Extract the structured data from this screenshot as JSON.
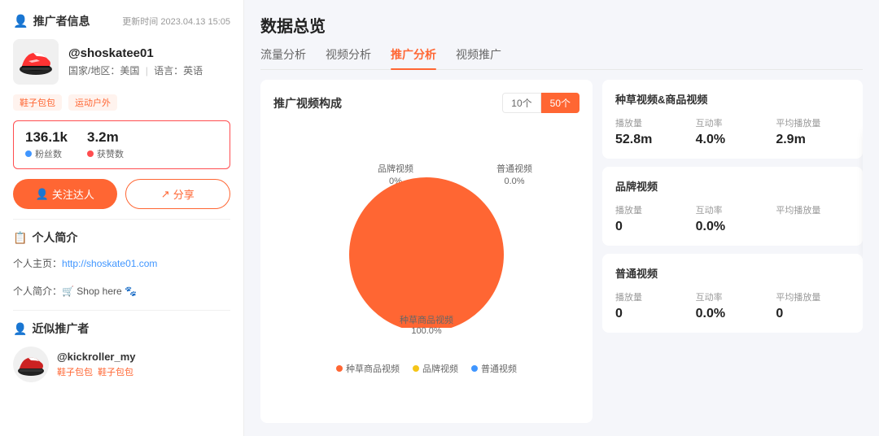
{
  "leftPanel": {
    "title": "推广者信息",
    "updateTime": "更新时间 2023.04.13 15:05",
    "username": "@shoskatee01",
    "country": "国家/地区：美国",
    "language": "语言：英语",
    "tags": [
      "鞋子包包",
      "运动户外"
    ],
    "followers": "136.1k",
    "likes": "3.2m",
    "followersLabel": "粉丝数",
    "likesLabel": "获赞数",
    "followBtn": "关注达人",
    "shareBtn": "分享",
    "bioTitle": "个人简介",
    "bioHome": "个人主页：http://shoskate01.com",
    "bioShop": "个人简介：🛒 Shop here 🐾",
    "similarTitle": "近似推广者",
    "similarUser": "@kickroller_my",
    "similarTag1": "鞋子包包",
    "similarTag2": "鞋子包包"
  },
  "rightPanel": {
    "mainTitle": "数据总览",
    "tabs": [
      "流量分析",
      "视频分析",
      "推广分析",
      "视频推广"
    ],
    "activeTab": 2,
    "sectionTitle": "推广视频构成",
    "chartBtns": [
      "10个",
      "50个"
    ],
    "activeChartBtn": 1,
    "pieData": {
      "seedCommerce": 100.0,
      "brand": 0.0,
      "normal": 0.0
    },
    "pieLabels": {
      "brand": "品牌视频\n0.0%",
      "normal": "普通视频\n0.0%",
      "seed": "种草商品视频\n100.0%"
    },
    "legend": [
      "种草商品视频",
      "品牌视频",
      "普通视频"
    ],
    "legendColors": [
      "#ff6633",
      "#f5c518",
      "#4096ff"
    ],
    "cards": [
      {
        "title": "种草视频&商品视频",
        "metrics": [
          {
            "label": "播放量",
            "value": "52.8m"
          },
          {
            "label": "互动率",
            "value": "4.0%"
          },
          {
            "label": "平均播放量",
            "value": "2.9m"
          }
        ]
      },
      {
        "title": "品牌视频",
        "metrics": [
          {
            "label": "播放量",
            "value": "0"
          },
          {
            "label": "互动率",
            "value": "0.0%"
          },
          {
            "label": "平均播放量",
            "value": ""
          }
        ]
      },
      {
        "title": "普通视频",
        "metrics": [
          {
            "label": "播放量",
            "value": "0"
          },
          {
            "label": "互动率",
            "value": "0.0%"
          },
          {
            "label": "平均播放量",
            "value": "0"
          }
        ]
      }
    ],
    "floatIcons": [
      "↑",
      "♛",
      "ꙮ",
      "⊞"
    ]
  }
}
